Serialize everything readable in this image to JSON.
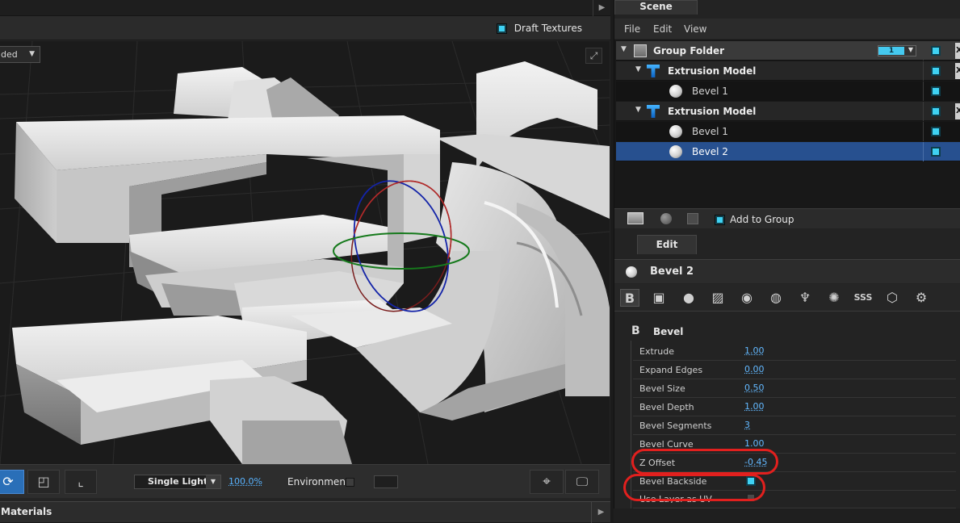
{
  "viewport": {
    "toolbar": {
      "draft_textures_label": "Draft Textures",
      "shading_mode_partial": "ded"
    },
    "bottom_toolbar": {
      "light_mode": "Single Light",
      "zoom_percent": "100.0%",
      "environment_label": "Environment"
    },
    "materials_title": "Materials"
  },
  "scene": {
    "tab_label": "Scene",
    "menu": {
      "file": "File",
      "edit": "Edit",
      "view": "View"
    },
    "tree": {
      "group_folder": {
        "label": "Group Folder",
        "count": "1"
      },
      "items": [
        {
          "label": "Extrusion Model"
        },
        {
          "label": "Bevel 1"
        },
        {
          "label": "Extrusion Model"
        },
        {
          "label": "Bevel 1"
        },
        {
          "label": "Bevel 2"
        }
      ]
    },
    "footer": {
      "add_to_group": "Add to Group"
    }
  },
  "edit": {
    "tab_label": "Edit",
    "title": "Bevel 2",
    "section_title": "Bevel",
    "properties": [
      {
        "label": "Extrude",
        "value": "1.00"
      },
      {
        "label": "Expand Edges",
        "value": "0.00"
      },
      {
        "label": "Bevel Size",
        "value": "0.50"
      },
      {
        "label": "Bevel Depth",
        "value": "1.00"
      },
      {
        "label": "Bevel Segments",
        "value": "3"
      },
      {
        "label": "Bevel Curve",
        "value": "1.00"
      },
      {
        "label": "Z Offset",
        "value": "-0.45"
      },
      {
        "label": "Bevel Backside",
        "checked": true
      },
      {
        "label": "Use Layer as UV",
        "checked": false
      }
    ]
  },
  "colors": {
    "accent_cyan": "#3fd2f3",
    "selection_blue": "#27508f",
    "value_blue": "#62b8ff",
    "annotation_red": "#e2201e"
  }
}
